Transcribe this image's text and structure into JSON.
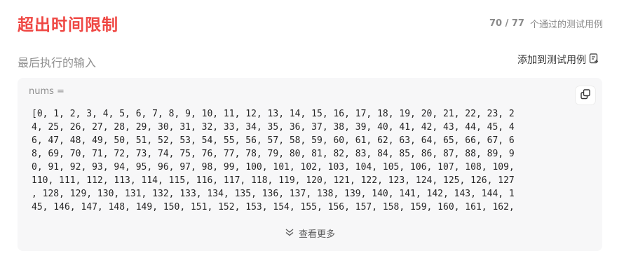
{
  "result": {
    "status": "超出时间限制",
    "passed": "70",
    "separator": "/",
    "total": "77",
    "passed_label": "个通过的测试用例",
    "status_color": "#ef4743"
  },
  "last_input": {
    "label": "最后执行的输入",
    "add_testcase_label": "添加到测试用例",
    "add_testcase_icon": "clipboard-add-icon",
    "copy_icon": "copy-icon",
    "param_name": "nums =",
    "lines": [
      "[0, 1, 2, 3, 4, 5, 6, 7, 8, 9, 10, 11, 12, 13, 14, 15, 16, 17, 18, 19, 20, 21, 22, 23, 2",
      "4, 25, 26, 27, 28, 29, 30, 31, 32, 33, 34, 35, 36, 37, 38, 39, 40, 41, 42, 43, 44, 45, 4",
      "6, 47, 48, 49, 50, 51, 52, 53, 54, 55, 56, 57, 58, 59, 60, 61, 62, 63, 64, 65, 66, 67, 6",
      "8, 69, 70, 71, 72, 73, 74, 75, 76, 77, 78, 79, 80, 81, 82, 83, 84, 85, 86, 87, 88, 89, 9",
      "0, 91, 92, 93, 94, 95, 96, 97, 98, 99, 100, 101, 102, 103, 104, 105, 106, 107, 108, 109,",
      "110, 111, 112, 113, 114, 115, 116, 117, 118, 119, 120, 121, 122, 123, 124, 125, 126, 127",
      ", 128, 129, 130, 131, 132, 133, 134, 135, 136, 137, 138, 139, 140, 141, 142, 143, 144, 1",
      "45, 146, 147, 148, 149, 150, 151, 152, 153, 154, 155, 156, 157, 158, 159, 160, 161, 162,"
    ],
    "show_more_label": "查看更多",
    "show_more_icon": "double-chevron-down-icon"
  }
}
